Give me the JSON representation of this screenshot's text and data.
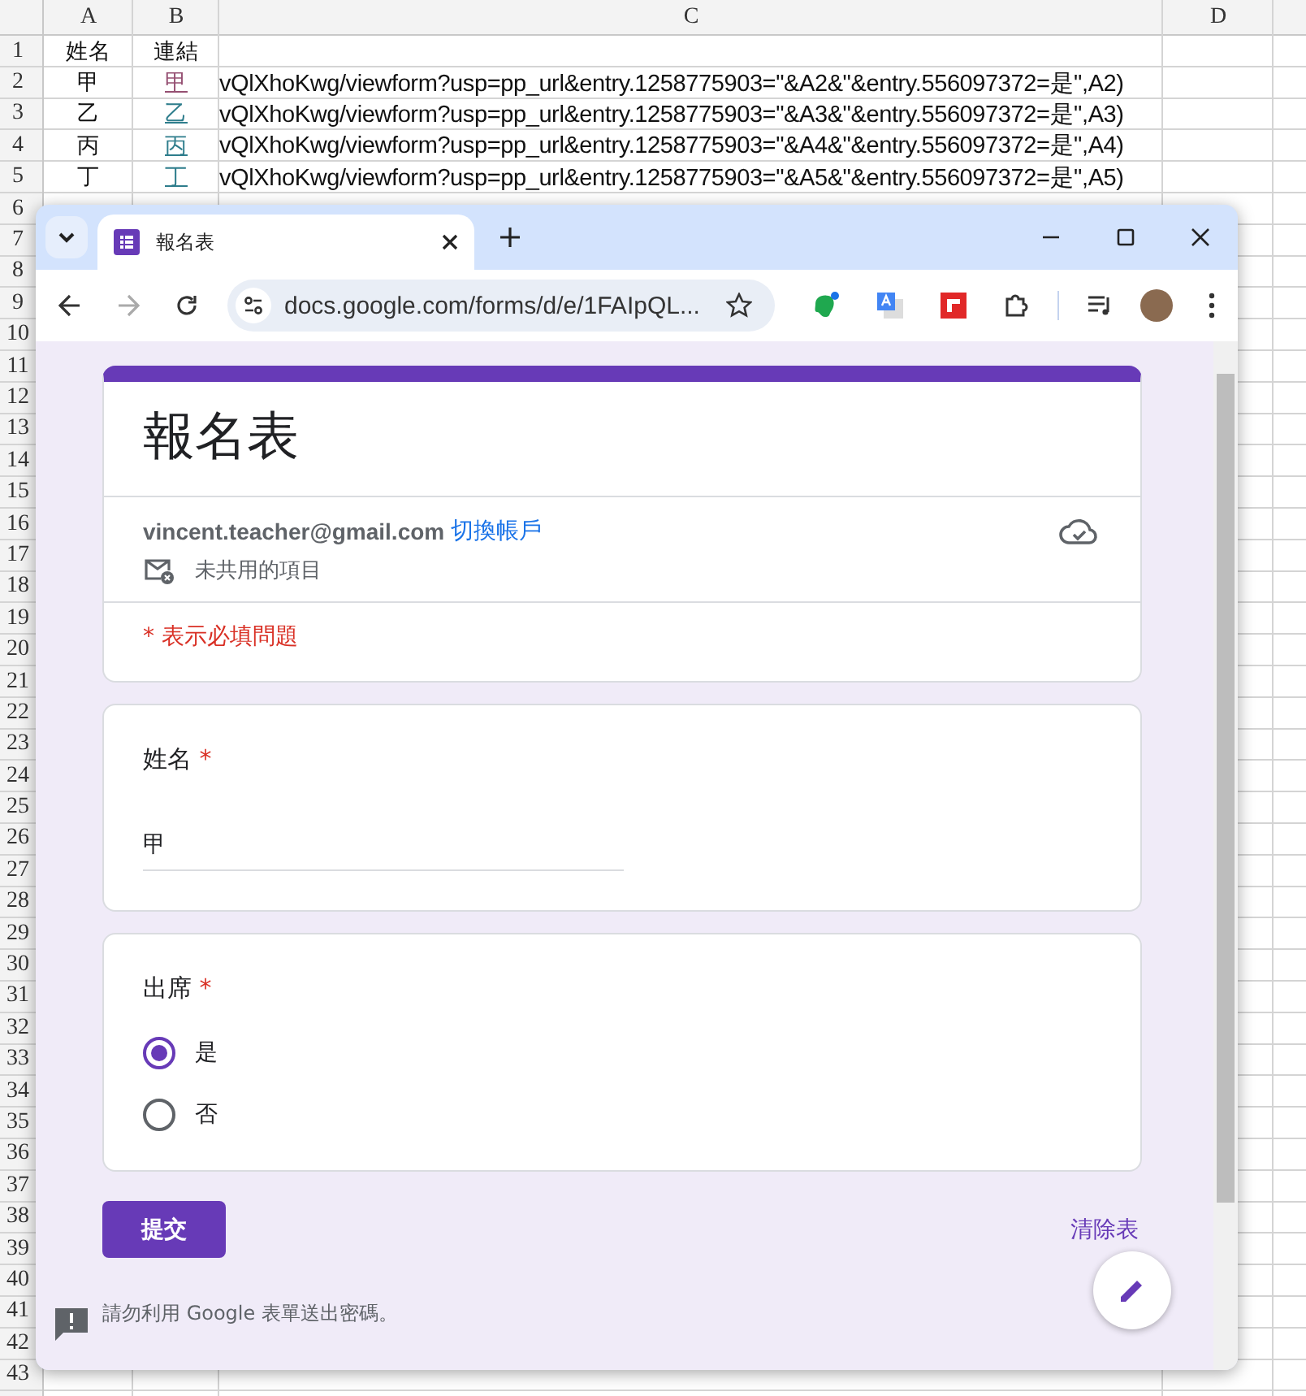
{
  "sheet": {
    "columns": [
      "A",
      "B",
      "C",
      "D"
    ],
    "row_numbers": [
      "1",
      "2",
      "3",
      "4",
      "5",
      "6",
      "7",
      "8",
      "9",
      "10",
      "11",
      "12",
      "13",
      "14",
      "15",
      "16",
      "17",
      "18",
      "19",
      "20",
      "21",
      "22",
      "23",
      "24",
      "25",
      "26",
      "27",
      "28",
      "29",
      "30",
      "31",
      "32",
      "33",
      "34",
      "35",
      "36",
      "37",
      "38",
      "39",
      "40",
      "41",
      "42",
      "43"
    ],
    "rows": [
      {
        "a": "姓名",
        "b": "連結"
      },
      {
        "a": "甲",
        "b_link": {
          "text": "甲",
          "visited": true
        },
        "c": "vQlXhoKwg/viewform?usp=pp_url&entry.1258775903=\"&A2&\"&entry.556097372=是\",A2)"
      },
      {
        "a": "乙",
        "b_link": {
          "text": "乙",
          "visited": false
        },
        "c": "vQlXhoKwg/viewform?usp=pp_url&entry.1258775903=\"&A3&\"&entry.556097372=是\",A3)"
      },
      {
        "a": "丙",
        "b_link": {
          "text": "丙",
          "visited": false
        },
        "c": "vQlXhoKwg/viewform?usp=pp_url&entry.1258775903=\"&A4&\"&entry.556097372=是\",A4)"
      },
      {
        "a": "丁",
        "b_link": {
          "text": "丁",
          "visited": false
        },
        "c": "vQlXhoKwg/viewform?usp=pp_url&entry.1258775903=\"&A5&\"&entry.556097372=是\",A5)"
      }
    ]
  },
  "browser": {
    "tab": {
      "title": "報名表",
      "selected": true
    },
    "url": "docs.google.com/forms/d/e/1FAIpQL..."
  },
  "form": {
    "title": "報名表",
    "account": "vincent.teacher@gmail.com",
    "switch_account": "切換帳戶",
    "not_shared": "未共用的項目",
    "required_note": "* 表示必填問題",
    "questions": [
      {
        "kind": "text",
        "title": "姓名",
        "required_mark": "*",
        "value": "甲"
      },
      {
        "kind": "radio",
        "title": "出席",
        "required_mark": "*",
        "options": [
          {
            "label": "是",
            "selected": true
          },
          {
            "label": "否",
            "selected": false
          }
        ]
      }
    ],
    "submit": "提交",
    "clear": "清除表",
    "footer": "請勿利用 Google 表單送出密碼。"
  }
}
